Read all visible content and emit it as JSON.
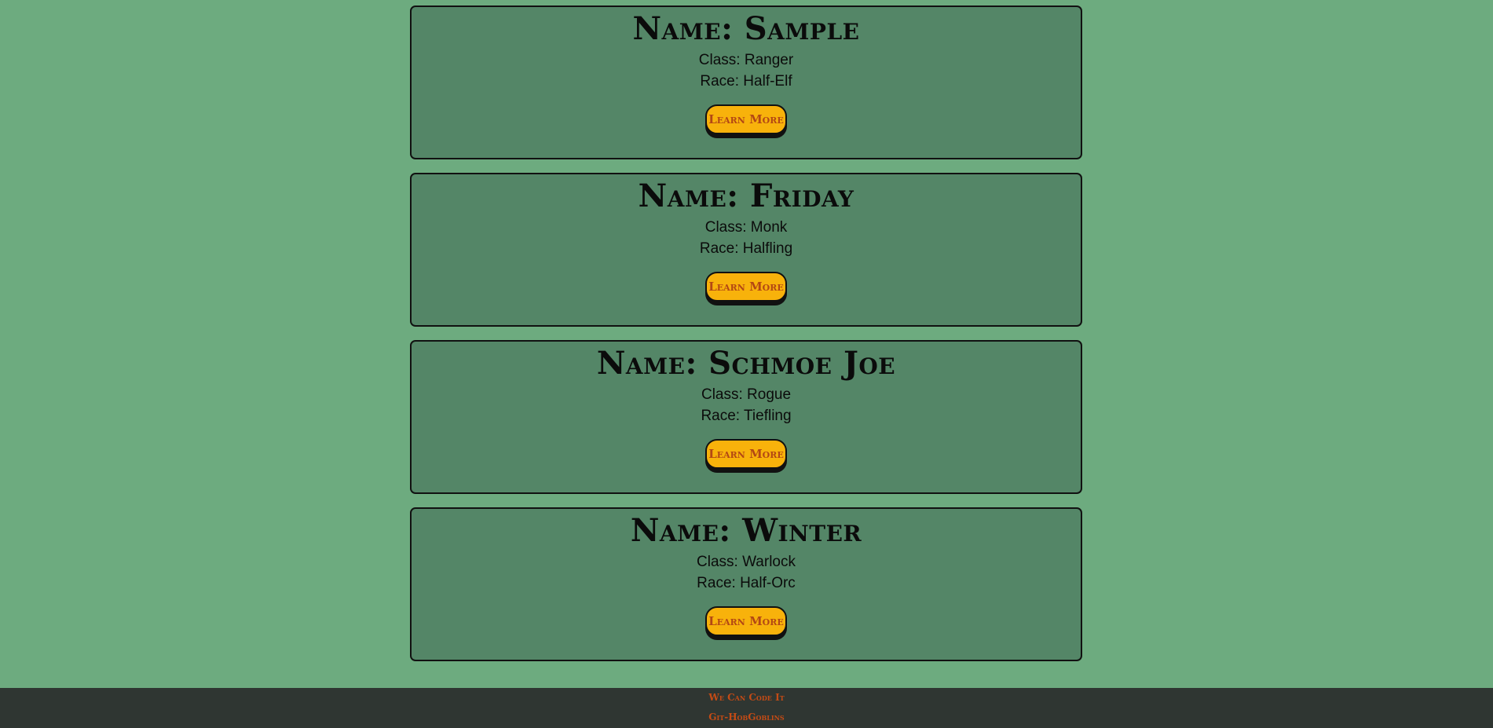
{
  "cards": [
    {
      "name": "Name: Sample",
      "class": "Class: Ranger",
      "race": "Race: Half-Elf",
      "button": "Learn More"
    },
    {
      "name": "Name: Friday",
      "class": "Class: Monk",
      "race": "Race: Halfling",
      "button": "Learn More"
    },
    {
      "name": "Name: Schmoe Joe",
      "class": "Class: Rogue",
      "race": "Race: Tiefling",
      "button": "Learn More"
    },
    {
      "name": "Name: Winter",
      "class": "Class: Warlock",
      "race": "Race: Half-Orc",
      "button": "Learn More"
    }
  ],
  "footer": {
    "line1": "We Can Code It",
    "line2": "Git-HobGoblins"
  },
  "colors": {
    "background": "#6dab7f",
    "card": "#548667",
    "button": "#f8b20b",
    "button_text": "#b34714",
    "footer_bg": "#2f3632",
    "footer_text": "#c44b15"
  }
}
